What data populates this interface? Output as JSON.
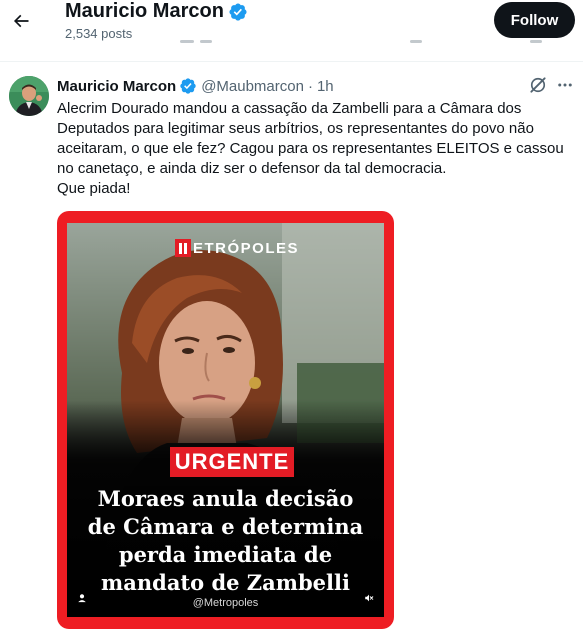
{
  "header": {
    "title": "Mauricio Marcon",
    "posts_count": "2,534 posts",
    "follow_label": "Follow"
  },
  "tweet": {
    "author_name": "Mauricio Marcon",
    "handle": "@Maubmarcon",
    "separator": "·",
    "time": "1h",
    "text_lines": [
      "Alecrim Dourado mandou a cassação da Zambelli para a Câmara dos Deputados para legitimar seus arbítrios, os representantes do povo não aceitaram, o que ele fez? Cagou para os representantes ELEITOS e cassou no canetaço, e ainda diz ser o defensor da tal democracia.",
      "Que piada!"
    ],
    "media": {
      "logo_text": "ETRÓPOLES",
      "badge": "URGENTE",
      "headline_lines": [
        "Moraes anula decisão",
        "de Câmara e determina",
        "perda imediata de",
        "mandato de Zambelli"
      ],
      "source": "@Metropoles"
    }
  },
  "colors": {
    "verified": "#1d9bf0",
    "frame_red": "#ee1d23",
    "badge_red": "#e31c25",
    "text_primary": "#0f1419",
    "text_secondary": "#536471",
    "follow_bg": "#0f1419"
  },
  "icons": {
    "back": "arrow-left-icon",
    "verified": "verified-badge-icon",
    "grok": "grok-icon",
    "more": "more-horizontal-icon",
    "user": "user-icon",
    "mute": "speaker-muted-icon"
  }
}
